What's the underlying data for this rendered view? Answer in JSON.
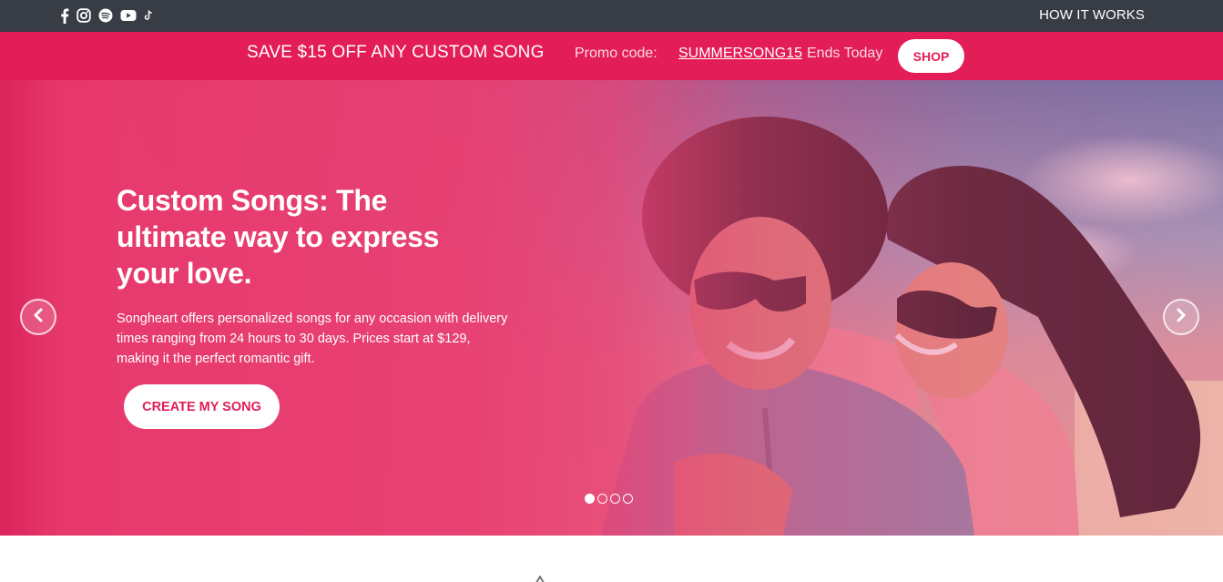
{
  "topbar": {
    "social_icons": [
      "facebook-icon",
      "instagram-icon",
      "spotify-icon",
      "youtube-icon",
      "tiktok-icon"
    ],
    "nav_link": "HOW IT WORKS"
  },
  "promo": {
    "headline": "SAVE $15 OFF ANY CUSTOM SONG",
    "code_label": "Promo code:",
    "code": "SUMMERSONG15",
    "ends": "Ends Today",
    "shop_label": "SHOP"
  },
  "hero": {
    "title": "Custom Songs: The ultimate way to express your love.",
    "description": "Songheart offers personalized songs for any occasion with delivery times ranging from 24 hours to 30 days. Prices start at $129, making it the perfect romantic gift.",
    "cta_label": "CREATE MY SONG",
    "prev_icon": "chevron-left-icon",
    "next_icon": "chevron-right-icon",
    "slides_total": 4,
    "active_slide": 1
  },
  "colors": {
    "topbar": "#373c45",
    "brand_pink": "#e21d57",
    "white": "#ffffff"
  }
}
